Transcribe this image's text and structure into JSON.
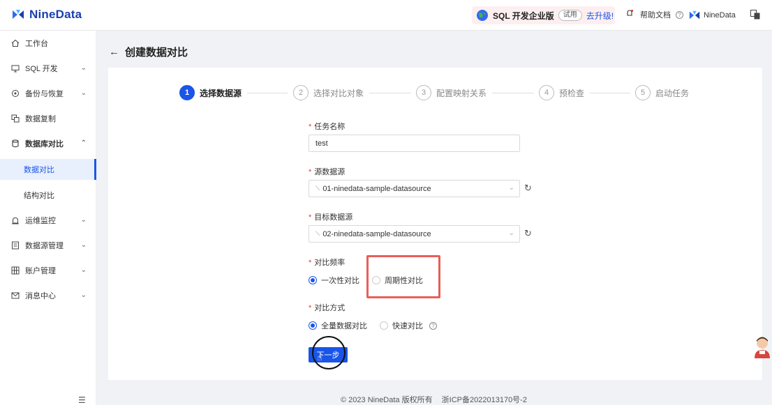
{
  "brand": {
    "name": "NineData"
  },
  "topbar": {
    "promo_label": "SQL 开发企业版",
    "trial_tag": "试用",
    "upgrade_link": "去升级!",
    "help_docs": "帮助文档",
    "account_name": "NineData"
  },
  "sidebar": {
    "items": [
      {
        "label": "工作台"
      },
      {
        "label": "SQL 开发"
      },
      {
        "label": "备份与恢复"
      },
      {
        "label": "数据复制"
      },
      {
        "label": "数据库对比"
      },
      {
        "label": "运维监控"
      },
      {
        "label": "数据源管理"
      },
      {
        "label": "账户管理"
      },
      {
        "label": "消息中心"
      }
    ],
    "subitems": [
      {
        "label": "数据对比"
      },
      {
        "label": "结构对比"
      }
    ]
  },
  "page": {
    "title": "创建数据对比"
  },
  "steps": [
    {
      "num": "1",
      "label": "选择数据源"
    },
    {
      "num": "2",
      "label": "选择对比对象"
    },
    {
      "num": "3",
      "label": "配置映射关系"
    },
    {
      "num": "4",
      "label": "预检查"
    },
    {
      "num": "5",
      "label": "启动任务"
    }
  ],
  "form": {
    "task_name": {
      "label": "任务名称",
      "value": "test"
    },
    "source": {
      "label": "源数据源",
      "value": "01-ninedata-sample-datasource"
    },
    "target": {
      "label": "目标数据源",
      "value": "02-ninedata-sample-datasource"
    },
    "frequency": {
      "label": "对比频率",
      "options": [
        "一次性对比",
        "周期性对比"
      ]
    },
    "method": {
      "label": "对比方式",
      "options": [
        "全量数据对比",
        "快速对比"
      ]
    },
    "next_button": "下一步"
  },
  "footer": {
    "copyright": "© 2023 NineData 版权所有",
    "icp": "浙ICP备2022013170号-2"
  },
  "colors": {
    "primary": "#1a55e8",
    "brand": "#1a3fae",
    "highlight": "#e85e57"
  }
}
